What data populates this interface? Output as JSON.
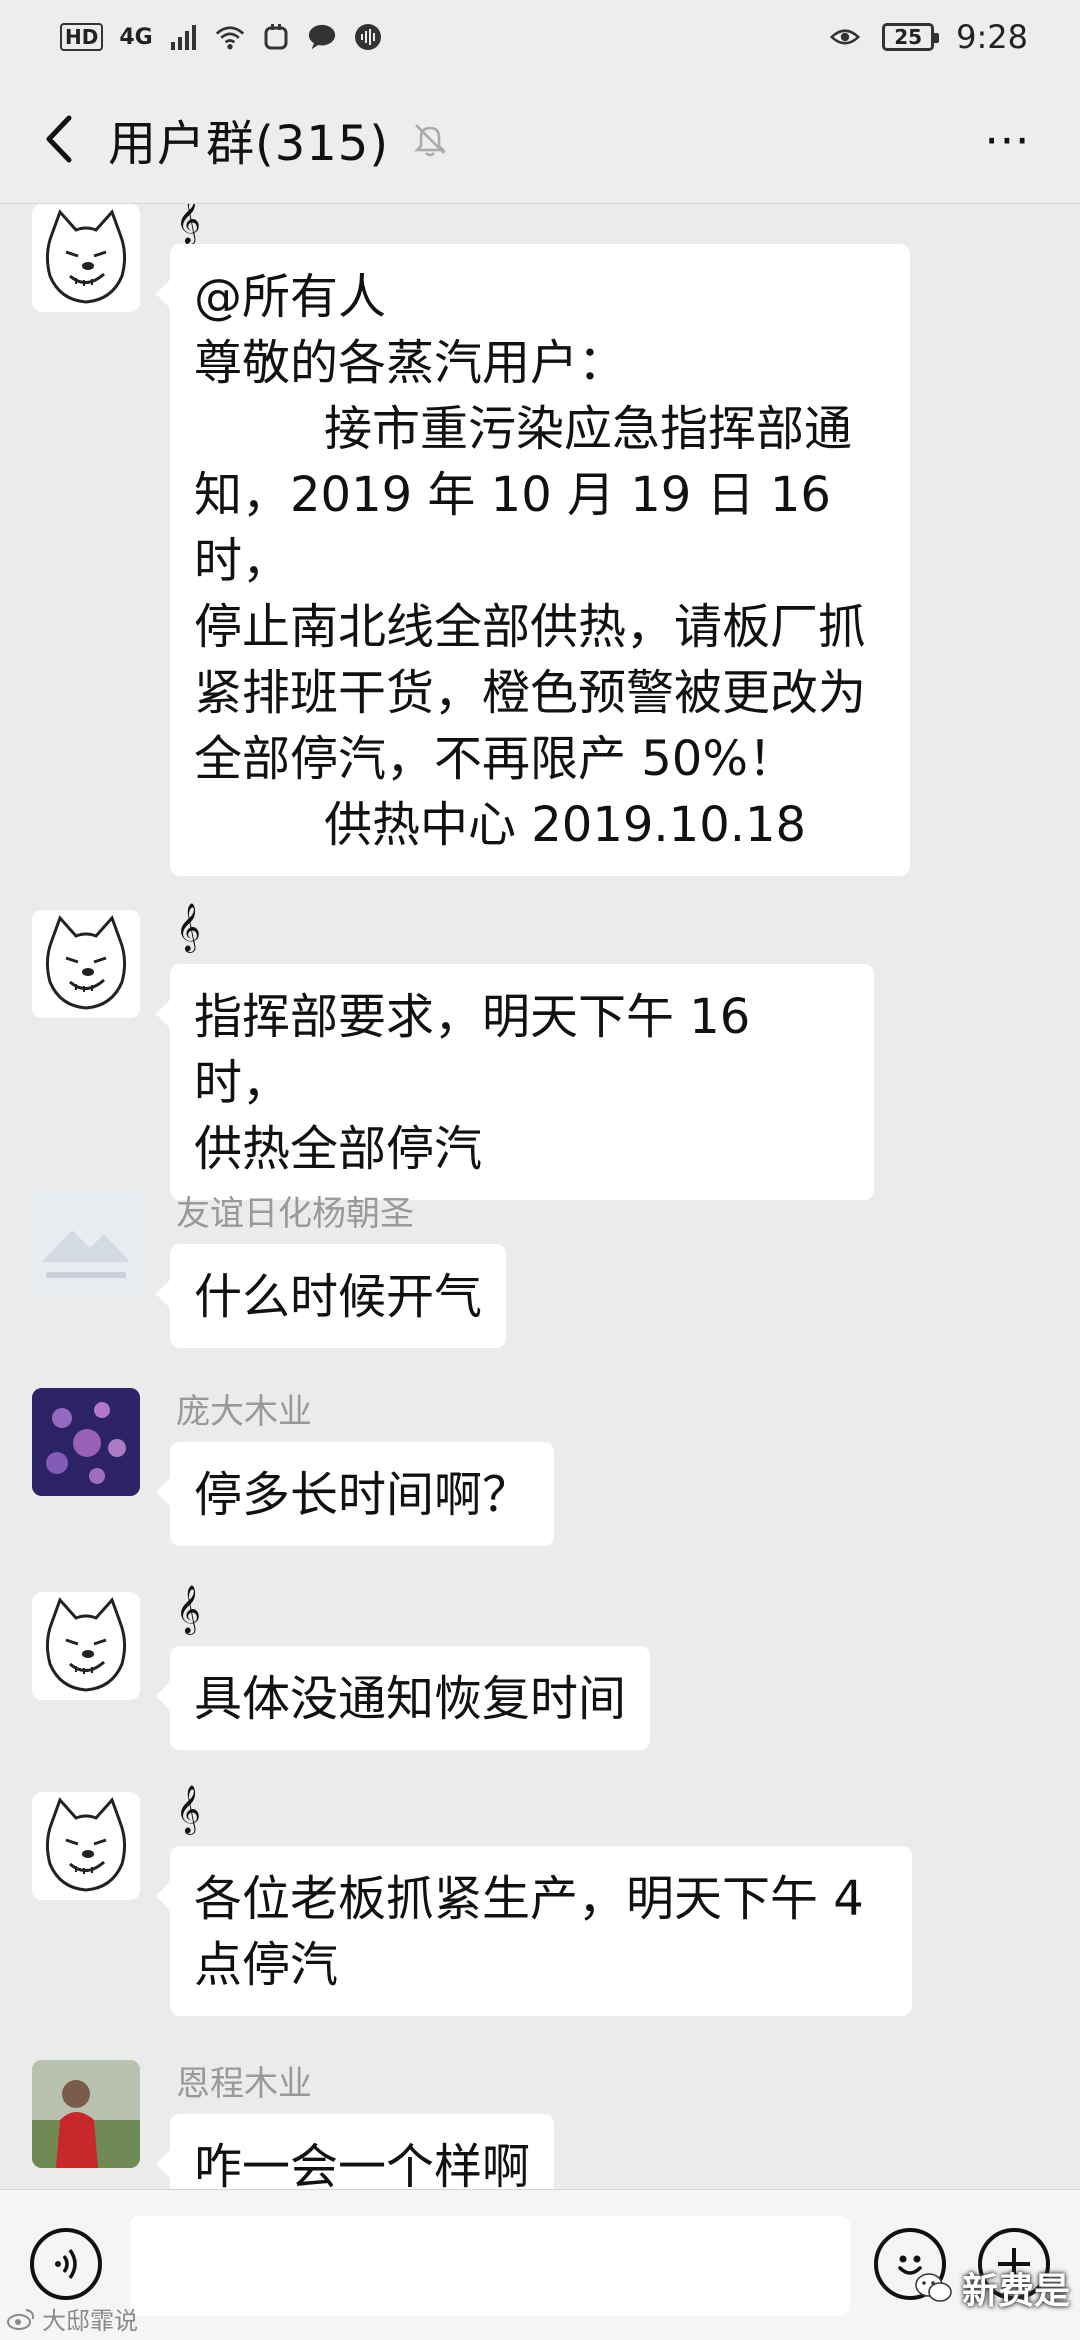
{
  "status_bar": {
    "network_hd": "HD",
    "network_4g": "4G",
    "battery_level": "25",
    "time": "9:28"
  },
  "nav": {
    "title": "用户群(315)",
    "more_label": "⋯"
  },
  "messages": [
    {
      "sender": "",
      "lines": [
        "@所有人",
        "尊敬的各蒸汽用户：",
        "接市重污染应急指挥部通",
        "知，2019 年 10 月 19 日 16 时，",
        "停止南北线全部供热，请板厂抓",
        "紧排班干货，橙色预警被更改为",
        "全部停汽，不再限产 50%！",
        "供热中心 2019.10.18"
      ]
    },
    {
      "sender": "",
      "lines": [
        "指挥部要求，明天下午 16 时，",
        "供热全部停汽"
      ]
    },
    {
      "sender": "友谊日化杨朝圣",
      "lines": [
        "什么时候开气"
      ]
    },
    {
      "sender": "庞大木业",
      "lines": [
        "停多长时间啊？"
      ]
    },
    {
      "sender": "",
      "lines": [
        "具体没通知恢复时间"
      ]
    },
    {
      "sender": "",
      "lines": [
        "各位老板抓紧生产，明天下午 4",
        "点停汽"
      ]
    },
    {
      "sender": "恩程木业",
      "lines": [
        "咋一会一个样啊"
      ]
    }
  ],
  "watermark": {
    "left": "大邸霏说",
    "right": "新费是"
  },
  "colors": {
    "background": "#ebebeb",
    "bubble": "#ffffff",
    "sender_name": "#999999"
  }
}
